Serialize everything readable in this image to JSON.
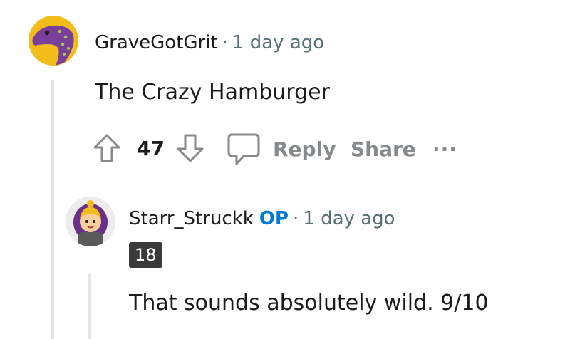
{
  "comments": [
    {
      "author": "GraveGotGrit",
      "separator": "·",
      "time": "1 day ago",
      "body": "The Crazy Hamburger",
      "votes": "47",
      "actions": {
        "reply": "Reply",
        "share": "Share",
        "more": "..."
      },
      "avatar_colors": {
        "background": "#f2bc1a",
        "creature": "#7a3f9a"
      }
    },
    {
      "author": "Starr_Struckk",
      "op_badge": "OP",
      "separator": "·",
      "time": "1 day ago",
      "flair": "18",
      "body": "That sounds absolutely wild. 9/10"
    }
  ],
  "colors": {
    "text": "#1c1c1c",
    "meta": "#576f76",
    "op": "#0079d3",
    "action": "#878a8c",
    "thread_line": "#e5e5e5",
    "flair_bg": "#3a3a3a"
  }
}
